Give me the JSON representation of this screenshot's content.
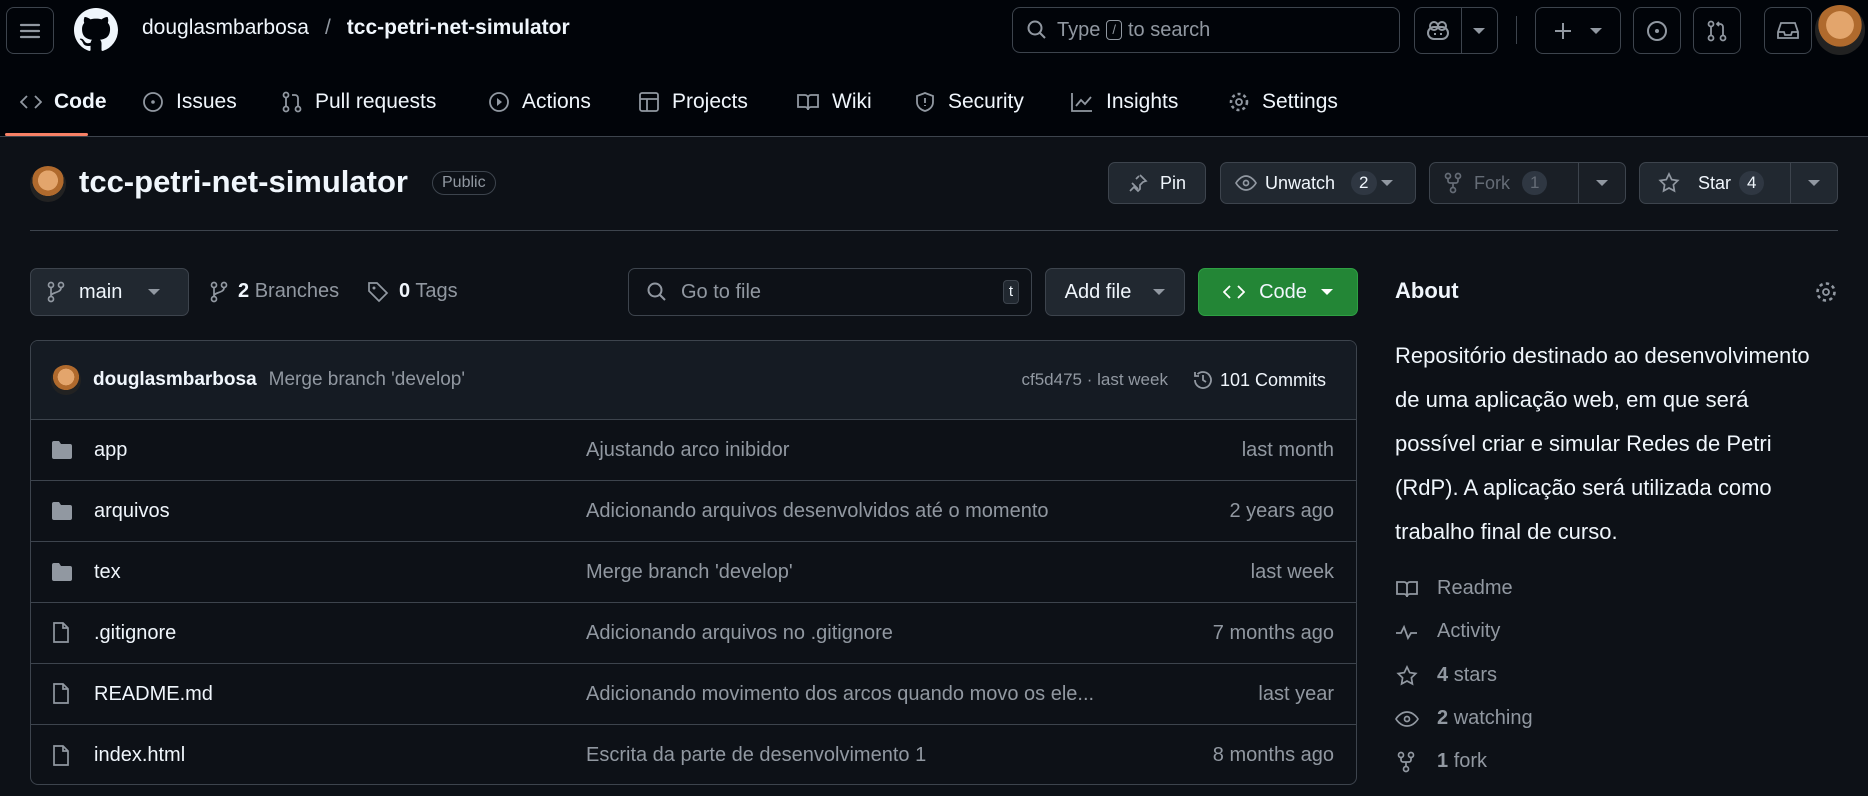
{
  "header": {
    "owner": "douglasmbarbosa",
    "separator": "/",
    "repo": "tcc-petri-net-simulator",
    "search_placeholder_pre": "Type",
    "search_key": "/",
    "search_placeholder_post": "to search"
  },
  "tabs": [
    {
      "label": "Code",
      "icon": "code-icon"
    },
    {
      "label": "Issues",
      "icon": "issue-icon"
    },
    {
      "label": "Pull requests",
      "icon": "pull-request-icon"
    },
    {
      "label": "Actions",
      "icon": "play-icon"
    },
    {
      "label": "Projects",
      "icon": "table-icon"
    },
    {
      "label": "Wiki",
      "icon": "book-icon"
    },
    {
      "label": "Security",
      "icon": "shield-icon"
    },
    {
      "label": "Insights",
      "icon": "graph-icon"
    },
    {
      "label": "Settings",
      "icon": "gear-icon"
    }
  ],
  "repo": {
    "name": "tcc-petri-net-simulator",
    "visibility": "Public",
    "pin": "Pin",
    "unwatch": "Unwatch",
    "watch_count": "2",
    "fork": "Fork",
    "fork_count": "1",
    "star": "Star",
    "star_count": "4"
  },
  "toolbar": {
    "branch": "main",
    "branches_count": "2",
    "branches_label": "Branches",
    "tags_count": "0",
    "tags_label": "Tags",
    "goto_placeholder": "Go to file",
    "goto_key": "t",
    "add_file": "Add file",
    "code": "Code"
  },
  "commit": {
    "author": "douglasmbarbosa",
    "message": "Merge branch 'develop'",
    "hash_time": "cf5d475 · last week",
    "commits": "101 Commits"
  },
  "files": [
    {
      "name": "app",
      "type": "folder",
      "message": "Ajustando arco inibidor",
      "date": "last month"
    },
    {
      "name": "arquivos",
      "type": "folder",
      "message": "Adicionando arquivos desenvolvidos até o momento",
      "date": "2 years ago"
    },
    {
      "name": "tex",
      "type": "folder",
      "message": "Merge branch 'develop'",
      "date": "last week"
    },
    {
      "name": ".gitignore",
      "type": "file",
      "message": "Adicionando arquivos no .gitignore",
      "date": "7 months ago"
    },
    {
      "name": "README.md",
      "type": "file",
      "message": "Adicionando movimento dos arcos quando movo os ele...",
      "date": "last year"
    },
    {
      "name": "index.html",
      "type": "file",
      "message": "Escrita da parte de desenvolvimento 1",
      "date": "8 months ago"
    }
  ],
  "about": {
    "title": "About",
    "description": "Repositório destinado ao desenvolvimento de uma aplicação web, em que será possível criar e simular Redes de Petri (RdP). A aplicação será utilizada como trabalho final de curso.",
    "readme": "Readme",
    "activity": "Activity",
    "stars_count": "4",
    "stars_label": "stars",
    "watching_count": "2",
    "watching_label": "watching",
    "forks_count": "1",
    "forks_label": "fork"
  }
}
